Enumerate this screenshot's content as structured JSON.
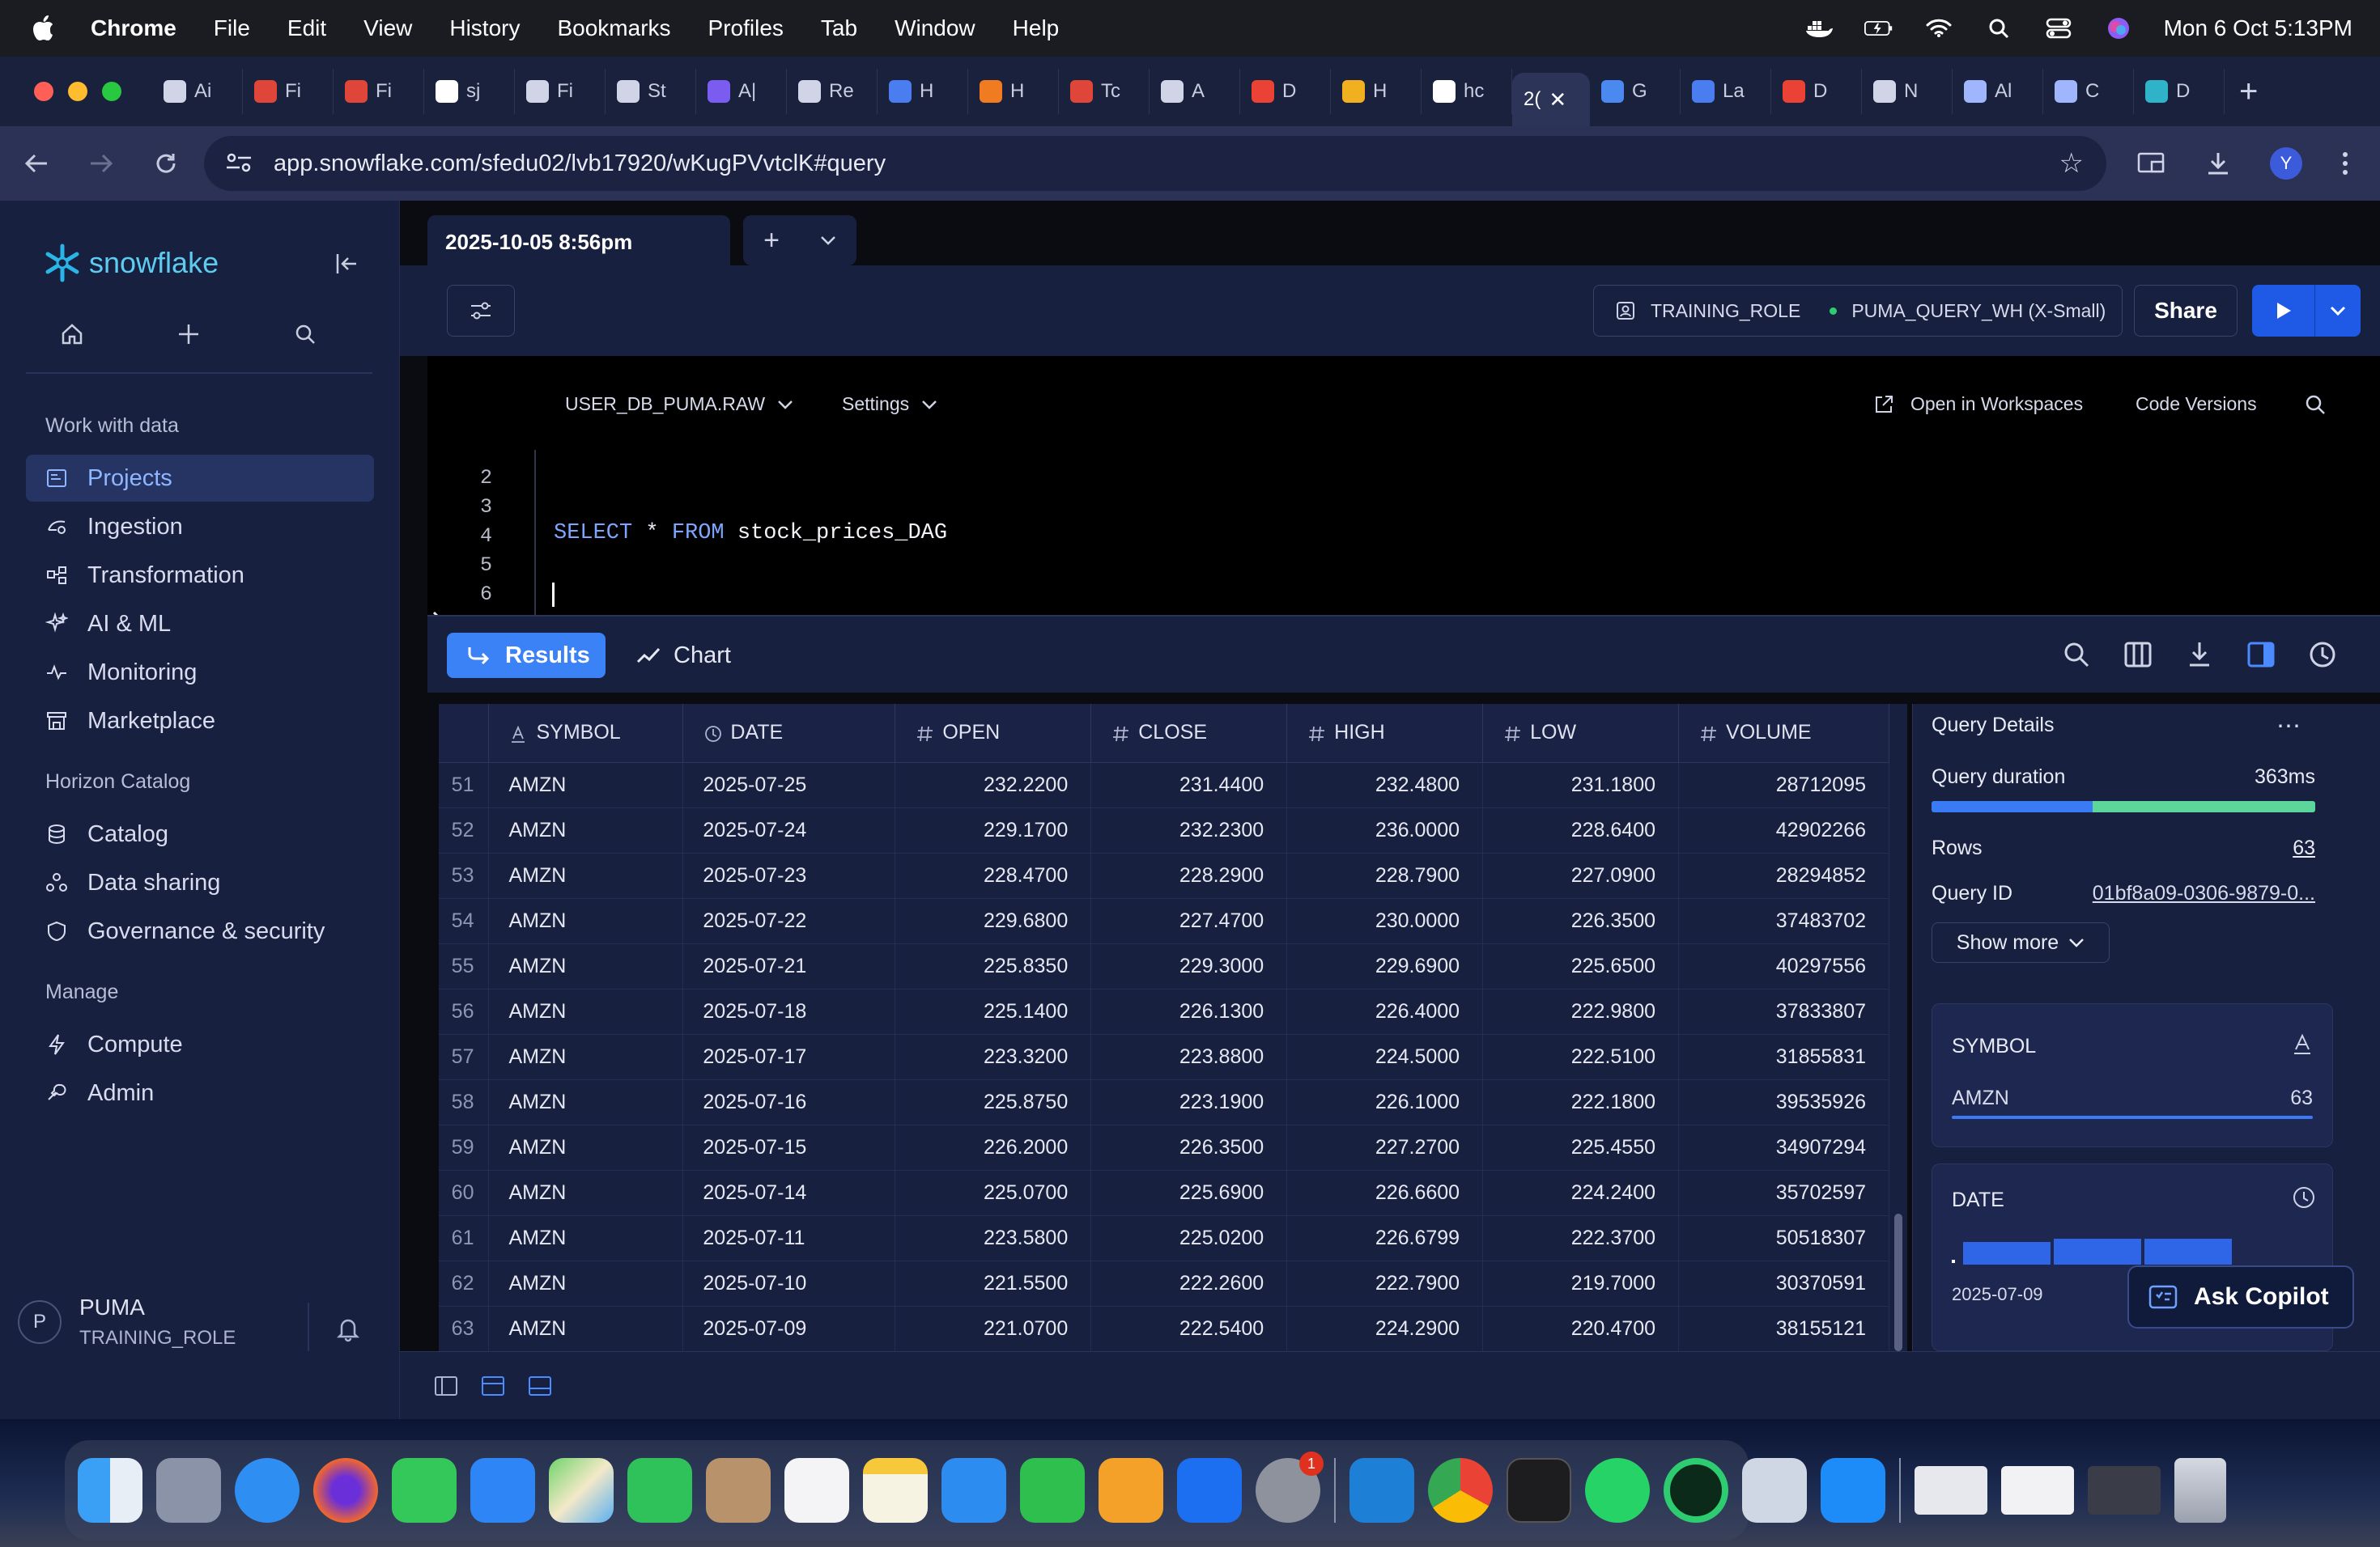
{
  "menubar": {
    "app": "Chrome",
    "items": [
      "File",
      "Edit",
      "View",
      "History",
      "Bookmarks",
      "Profiles",
      "Tab",
      "Window",
      "Help"
    ],
    "datetime": "Mon 6 Oct  5:13PM"
  },
  "browser": {
    "tabs": [
      {
        "label": "Ai",
        "icon": "openai-icon",
        "color": "#d0d4e6"
      },
      {
        "label": "Fi",
        "icon": "airflow-icon",
        "color": "#e0453a"
      },
      {
        "label": "Fi",
        "icon": "airflow-icon",
        "color": "#e0453a"
      },
      {
        "label": "sj",
        "icon": "github-icon",
        "color": "#ffffff"
      },
      {
        "label": "Fi",
        "icon": "openai-icon",
        "color": "#d0d4e6"
      },
      {
        "label": "St",
        "icon": "openai-icon",
        "color": "#d0d4e6"
      },
      {
        "label": "A|",
        "icon": "app-icon",
        "color": "#7b5cf0"
      },
      {
        "label": "Re",
        "icon": "openai-icon",
        "color": "#d0d4e6"
      },
      {
        "label": "H",
        "icon": "docs-icon",
        "color": "#4a7df0"
      },
      {
        "label": "H",
        "icon": "loader-icon",
        "color": "#f07b20"
      },
      {
        "label": "Tc",
        "icon": "airflow-icon",
        "color": "#e0453a"
      },
      {
        "label": "A",
        "icon": "openai-icon",
        "color": "#d0d4e6"
      },
      {
        "label": "D",
        "icon": "gmail-icon",
        "color": "#ea4335"
      },
      {
        "label": "H",
        "icon": "infinity-icon",
        "color": "#f0b020"
      },
      {
        "label": "hc",
        "icon": "google-icon",
        "color": "#ffffff"
      },
      {
        "label": "2(",
        "icon": "",
        "color": "",
        "active": true
      },
      {
        "label": "G",
        "icon": "gemini-icon",
        "color": "#4a8af0"
      },
      {
        "label": "La",
        "icon": "docs-icon",
        "color": "#4a7df0"
      },
      {
        "label": "D",
        "icon": "gmail-icon",
        "color": "#ea4335"
      },
      {
        "label": "N",
        "icon": "chrome-icon",
        "color": "#d0d4e6"
      },
      {
        "label": "Al",
        "icon": "anthropic-icon",
        "color": "#9fb6ff"
      },
      {
        "label": "C",
        "icon": "anthropic-icon",
        "color": "#9fb6ff"
      },
      {
        "label": "D",
        "icon": "airflow-pinwheel-icon",
        "color": "#2fb3c8"
      }
    ],
    "active_tab_close": "✕",
    "new_tab": "+",
    "url": "app.snowflake.com/sfedu02/lvb17920/wKugPVvtclK#query",
    "profile_initial": "Y"
  },
  "sidebar": {
    "brand": "snowflake",
    "section_work": "Work with data",
    "work_items": [
      {
        "label": "Projects",
        "icon": "projects-icon",
        "active": true
      },
      {
        "label": "Ingestion",
        "icon": "ingestion-icon"
      },
      {
        "label": "Transformation",
        "icon": "transformation-icon"
      },
      {
        "label": "AI & ML",
        "icon": "ai-ml-icon"
      },
      {
        "label": "Monitoring",
        "icon": "monitoring-icon"
      },
      {
        "label": "Marketplace",
        "icon": "marketplace-icon"
      }
    ],
    "section_horizon": "Horizon Catalog",
    "horizon_items": [
      {
        "label": "Catalog",
        "icon": "catalog-icon"
      },
      {
        "label": "Data sharing",
        "icon": "data-sharing-icon"
      },
      {
        "label": "Governance & security",
        "icon": "governance-icon"
      }
    ],
    "section_manage": "Manage",
    "manage_items": [
      {
        "label": "Compute",
        "icon": "compute-icon"
      },
      {
        "label": "Admin",
        "icon": "admin-icon"
      }
    ],
    "user": {
      "initial": "P",
      "name": "PUMA",
      "role": "TRAINING_ROLE"
    }
  },
  "worksheet": {
    "tab_title": "2025-10-05 8:56pm",
    "role": "TRAINING_ROLE",
    "warehouse": "PUMA_QUERY_WH (X-Small)",
    "share_label": "Share",
    "database": "USER_DB_PUMA.RAW",
    "settings_label": "Settings",
    "open_workspaces": "Open in Workspaces",
    "code_versions": "Code Versions",
    "line_numbers": [
      "2",
      "3",
      "4",
      "5",
      "6"
    ],
    "code": {
      "kw1": "SELECT",
      "star": "*",
      "kw2": "FROM",
      "table": "stock_prices_DAG"
    }
  },
  "results": {
    "results_tab": "Results",
    "chart_tab": "Chart",
    "columns": [
      {
        "name": "SYMBOL",
        "type": "text"
      },
      {
        "name": "DATE",
        "type": "date"
      },
      {
        "name": "OPEN",
        "type": "number"
      },
      {
        "name": "CLOSE",
        "type": "number"
      },
      {
        "name": "HIGH",
        "type": "number"
      },
      {
        "name": "LOW",
        "type": "number"
      },
      {
        "name": "VOLUME",
        "type": "number"
      }
    ],
    "rows": [
      [
        "51",
        "AMZN",
        "2025-07-25",
        "232.2200",
        "231.4400",
        "232.4800",
        "231.1800",
        "28712095"
      ],
      [
        "52",
        "AMZN",
        "2025-07-24",
        "229.1700",
        "232.2300",
        "236.0000",
        "228.6400",
        "42902266"
      ],
      [
        "53",
        "AMZN",
        "2025-07-23",
        "228.4700",
        "228.2900",
        "228.7900",
        "227.0900",
        "28294852"
      ],
      [
        "54",
        "AMZN",
        "2025-07-22",
        "229.6800",
        "227.4700",
        "230.0000",
        "226.3500",
        "37483702"
      ],
      [
        "55",
        "AMZN",
        "2025-07-21",
        "225.8350",
        "229.3000",
        "229.6900",
        "225.6500",
        "40297556"
      ],
      [
        "56",
        "AMZN",
        "2025-07-18",
        "225.1400",
        "226.1300",
        "226.4000",
        "222.9800",
        "37833807"
      ],
      [
        "57",
        "AMZN",
        "2025-07-17",
        "223.3200",
        "223.8800",
        "224.5000",
        "222.5100",
        "31855831"
      ],
      [
        "58",
        "AMZN",
        "2025-07-16",
        "225.8750",
        "223.1900",
        "226.1000",
        "222.1800",
        "39535926"
      ],
      [
        "59",
        "AMZN",
        "2025-07-15",
        "226.2000",
        "226.3500",
        "227.2700",
        "225.4550",
        "34907294"
      ],
      [
        "60",
        "AMZN",
        "2025-07-14",
        "225.0700",
        "225.6900",
        "226.6600",
        "224.2400",
        "35702597"
      ],
      [
        "61",
        "AMZN",
        "2025-07-11",
        "223.5800",
        "225.0200",
        "226.6799",
        "222.3700",
        "50518307"
      ],
      [
        "62",
        "AMZN",
        "2025-07-10",
        "221.5500",
        "222.2600",
        "222.7900",
        "219.7000",
        "30370591"
      ],
      [
        "63",
        "AMZN",
        "2025-07-09",
        "221.0700",
        "222.5400",
        "224.2900",
        "220.4700",
        "38155121"
      ]
    ]
  },
  "details": {
    "title": "Query Details",
    "duration_label": "Query duration",
    "duration_value": "363ms",
    "duration_split": 0.42,
    "rows_label": "Rows",
    "rows_value": "63",
    "qid_label": "Query ID",
    "qid_value": "01bf8a09-0306-9879-0...",
    "show_more": "Show more",
    "symbol_card": {
      "title": "SYMBOL",
      "value": "AMZN",
      "count": "63"
    },
    "date_card": {
      "title": "DATE",
      "min_label": "2025-07-09"
    },
    "copilot": "Ask Copilot"
  },
  "colors": {
    "accent": "#3b82f6",
    "run": "#1e5ae6",
    "keyword": "#7ea6ff",
    "success": "#2ecc71"
  },
  "dock": {
    "settings_badge": "1"
  }
}
